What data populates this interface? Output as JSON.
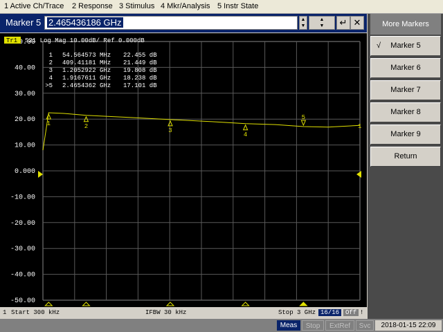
{
  "menu": [
    "1 Active Ch/Trace",
    "2 Response",
    "3 Stimulus",
    "4 Mkr/Analysis",
    "5 Instr State"
  ],
  "entry": {
    "label": "Marker 5",
    "value": "2.465436186 GHz",
    "enter_glyph": "↵",
    "close_glyph": "✕"
  },
  "trace": {
    "tag": "Tr1",
    "header": "S21  Log Mag 10.00dB/ Ref 0.000dB"
  },
  "markers_table": [
    {
      "num": "1",
      "freq": "54.564573 MHz",
      "val": "22.455 dB"
    },
    {
      "num": "2",
      "freq": "409.41181 MHz",
      "val": "21.449 dB"
    },
    {
      "num": "3",
      "freq": "1.2052922 GHz",
      "val": "19.808 dB"
    },
    {
      "num": "4",
      "freq": "1.9167611 GHz",
      "val": "18.238 dB"
    },
    {
      "num": ">5",
      "freq": "2.4654362 GHz",
      "val": "17.101 dB"
    }
  ],
  "chart_data": {
    "type": "line",
    "ylabel_ticks": [
      "50.00",
      "40.00",
      "30.00",
      "20.00",
      "10.00",
      "0.000",
      "-10.00",
      "-20.00",
      "-30.00",
      "-40.00",
      "-50.00"
    ],
    "ylim": [
      -50,
      50
    ],
    "xlim_ghz": [
      0.0003,
      3
    ],
    "series": [
      {
        "x": [
          0.0003,
          0.0546,
          0.2,
          0.4094,
          0.8,
          1.2053,
          1.6,
          1.9168,
          2.2,
          2.4654,
          2.7,
          3.0
        ],
        "values": [
          8,
          22.455,
          22.2,
          21.449,
          20.7,
          19.808,
          19.0,
          18.238,
          17.9,
          17.101,
          16.9,
          17.6
        ]
      }
    ],
    "marker_labels": [
      "1",
      "2",
      "3",
      "4",
      "5"
    ],
    "ref_level": "0.000"
  },
  "status": {
    "ch": "1",
    "start": "Start 300 kHz",
    "ifbw": "IFBW 30 kHz",
    "stop": "Stop 3 GHz",
    "points": "16/16",
    "off": "Off",
    "bang": "!"
  },
  "bottom": {
    "meas": "Meas",
    "stop": "Stop",
    "extref": "ExtRef",
    "svc": "Svc",
    "datetime": "2018-01-15 22:09"
  },
  "side": {
    "title": "More Markers",
    "items": [
      "Marker 5",
      "Marker 6",
      "Marker 7",
      "Marker 8",
      "Marker 9"
    ],
    "check": "√",
    "ret": "Return"
  },
  "colors": {
    "trace": "#e0e000",
    "grid": "#5a5a5a",
    "axis_text": "#ffffff"
  }
}
